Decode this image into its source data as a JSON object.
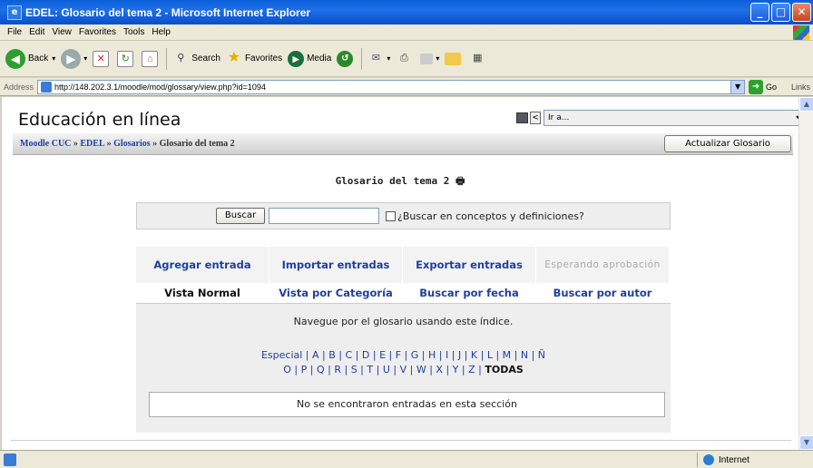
{
  "window": {
    "title": "EDEL: Glosario del tema 2 - Microsoft Internet Explorer"
  },
  "menu": [
    "File",
    "Edit",
    "View",
    "Favorites",
    "Tools",
    "Help"
  ],
  "toolbar": {
    "back": "Back",
    "search": "Search",
    "favorites": "Favorites",
    "media": "Media"
  },
  "address": {
    "label": "Address",
    "url": "http://148.202.3.1/moodle/mod/glossary/view.php?id=1094",
    "go": "Go",
    "links": "Links"
  },
  "site": {
    "name": "Educación en línea",
    "jump_placeholder": "Ir a..."
  },
  "breadcrumb": {
    "root": "Moodle CUC",
    "sep": "»",
    "course": "EDEL",
    "module": "Glosarios",
    "current": "Glosario del tema 2"
  },
  "update_button": "Actualizar Glosario",
  "glossary_title": "Glosario del tema 2",
  "search": {
    "button": "Buscar",
    "checkbox_label": "¿Buscar en conceptos y definiciones?"
  },
  "tabs_top": [
    "Agregar entrada",
    "Importar entradas",
    "Exportar entradas",
    "Esperando aprobación"
  ],
  "tabs_bottom": [
    "Vista Normal",
    "Vista por Categoría",
    "Buscar por fecha",
    "Buscar por autor"
  ],
  "browse_text": "Navegue por el glosario usando este índice.",
  "alpha_row1": [
    "Especial",
    "A",
    "B",
    "C",
    "D",
    "E",
    "F",
    "G",
    "H",
    "I",
    "J",
    "K",
    "L",
    "M",
    "N",
    "Ñ"
  ],
  "alpha_row2": [
    "O",
    "P",
    "Q",
    "R",
    "S",
    "T",
    "U",
    "V",
    "W",
    "X",
    "Y",
    "Z",
    "TODAS"
  ],
  "no_entries": "No se encontraron entradas en esta sección",
  "status": {
    "zone": "Internet"
  }
}
